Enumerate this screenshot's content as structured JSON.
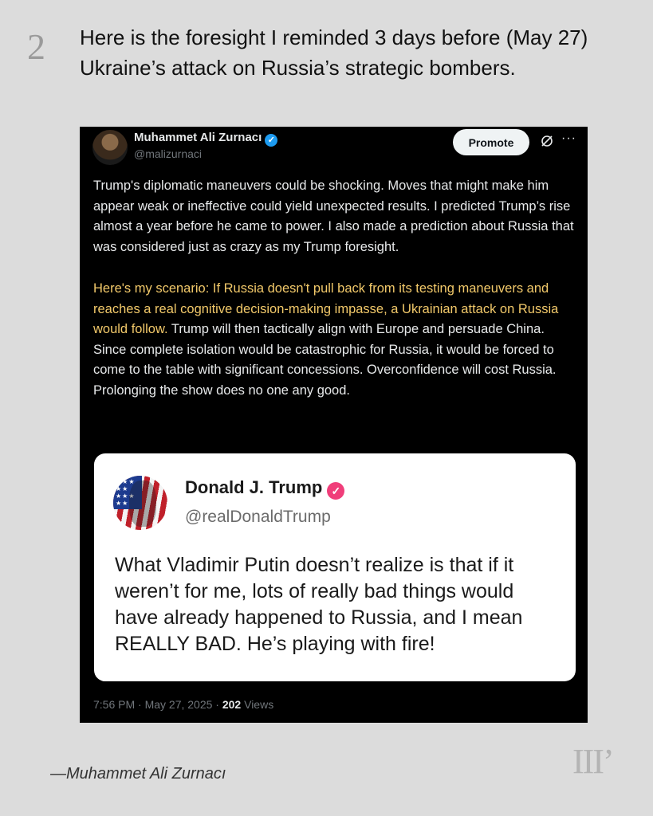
{
  "slide": {
    "number": "2",
    "heading": "Here is the foresight I reminded 3 days before (May 27) Ukraine’s attack on Russia’s strategic bombers."
  },
  "tweet": {
    "author_name": "Muhammet Ali Zurnacı",
    "author_handle": "@malizurnaci",
    "promote_label": "Promote",
    "paragraph1": "Trump's diplomatic maneuvers could be shocking. Moves that might make him appear weak or ineffective could yield unexpected results. I predicted Trump’s rise almost a year before he came to power. I also made a prediction about Russia that was considered just as crazy as my Trump foresight.",
    "paragraph2_highlight": "Here's my scenario: If Russia doesn't pull back from its testing maneuvers and reaches a real cognitive decision-making impasse, a Ukrainian attack on Russia would follow.",
    "paragraph2_rest": " Trump will then tactically align with Europe and persuade China. Since complete isolation would be catastrophic for Russia, it would be forced to come to the table with significant concessions. Overconfidence will cost Russia. Prolonging the show does no one any good.",
    "timestamp": "7:56 PM · May 27, 2025 · ",
    "views_count": "202",
    "views_label": " Views",
    "highlight_color": "#f2c96a",
    "verified_color": "#1d9bf0"
  },
  "quote": {
    "name": "Donald J. Trump",
    "handle": "@realDonaldTrump",
    "text": "What Vladimir Putin doesn’t realize is that if it weren’t for me, lots of really bad things would have already happened to Russia, and I mean REALLY BAD. He’s playing with fire!",
    "verified_color": "#f03e7a"
  },
  "footer": {
    "attribution": "—Muhammet Ali Zurnacı",
    "logo": "III’"
  }
}
